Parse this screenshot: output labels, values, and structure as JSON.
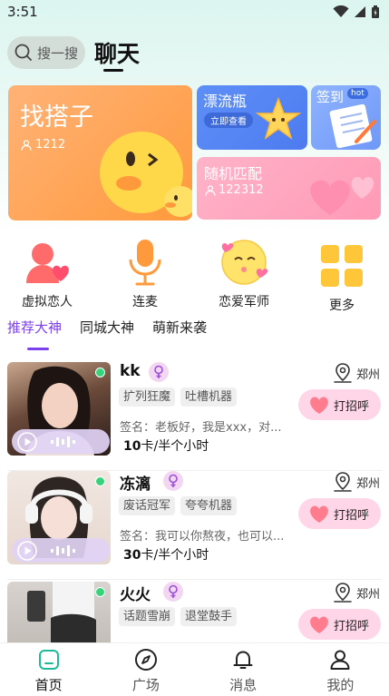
{
  "status_bar": {
    "time": "3:51"
  },
  "header": {
    "search_label": "搜一搜",
    "title": "聊天"
  },
  "feature_cards": {
    "partner": {
      "title": "找搭子",
      "count": "1212"
    },
    "drift_bottle": {
      "title": "漂流瓶",
      "button": "立即查看"
    },
    "sign_in": {
      "title": "签到",
      "badge": "hot"
    },
    "random_match": {
      "title": "随机匹配",
      "count": "122312"
    }
  },
  "shortcuts": [
    {
      "label": "虚拟恋人",
      "icon": "virtual-lover-icon"
    },
    {
      "label": "连麦",
      "icon": "microphone-icon"
    },
    {
      "label": "恋爱军师",
      "icon": "love-advisor-icon"
    },
    {
      "label": "更多",
      "icon": "more-grid-icon"
    }
  ],
  "tabs": [
    {
      "label": "推荐大神",
      "active": true
    },
    {
      "label": "同城大神",
      "active": false
    },
    {
      "label": "萌新来袭",
      "active": false
    }
  ],
  "list": [
    {
      "name": "kk",
      "location": "郑州",
      "tags": [
        "扩列狂魔",
        "吐槽机器"
      ],
      "signature": "签名：老板好，我是xxx，对...",
      "price_value": "10",
      "price_unit": "卡/半个小时",
      "greet": "打招呼"
    },
    {
      "name": "冻漓",
      "location": "郑州",
      "tags": [
        "废话冠军",
        "夸夸机器"
      ],
      "signature": "签名：我可以你熬夜，也可以...",
      "price_value": "30",
      "price_unit": "卡/半个小时",
      "greet": "打招呼"
    },
    {
      "name": "火火",
      "location": "郑州",
      "tags": [
        "话题雪崩",
        "退堂鼓手"
      ],
      "greet": "打招呼"
    }
  ],
  "bottom_nav": [
    {
      "label": "首页",
      "icon": "home-icon",
      "active": true
    },
    {
      "label": "广场",
      "icon": "compass-icon",
      "active": false
    },
    {
      "label": "消息",
      "icon": "bell-icon",
      "active": false
    },
    {
      "label": "我的",
      "icon": "person-icon",
      "active": false
    }
  ],
  "colors": {
    "accent": "#7c3ff0",
    "online": "#36d37a",
    "greet_bg": "#ffd6e7",
    "nav_active": "#1fb99a"
  }
}
